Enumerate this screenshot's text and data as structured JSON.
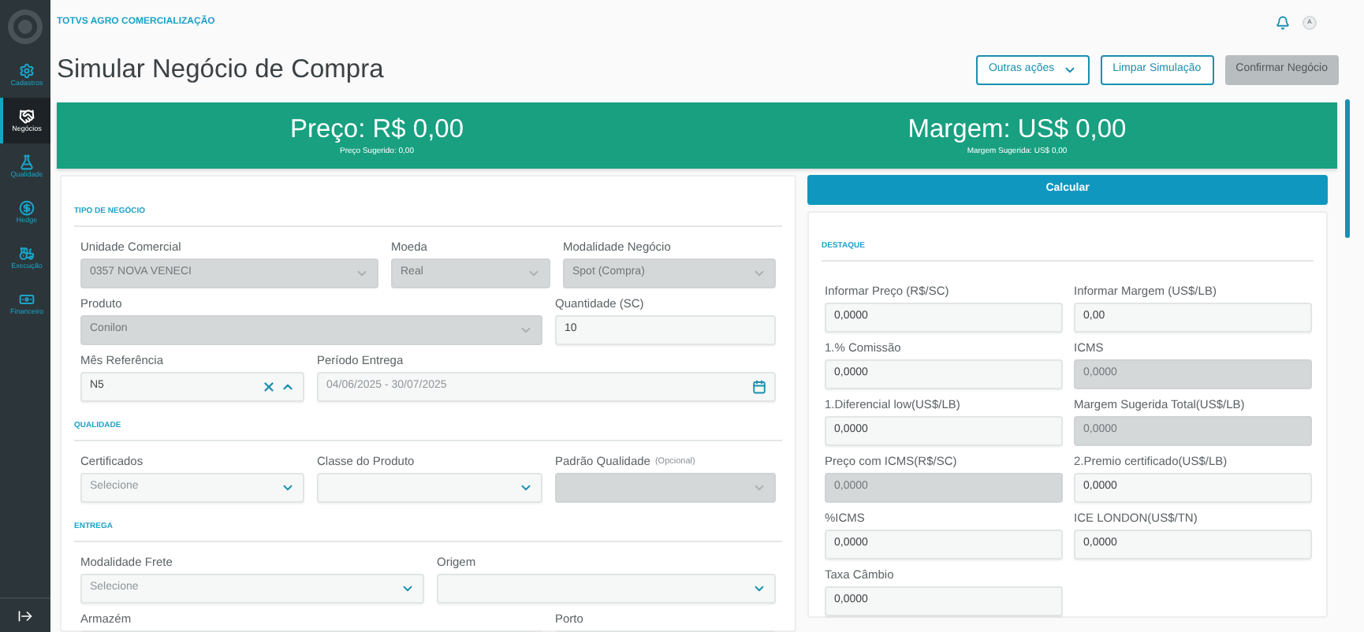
{
  "sidebar": {
    "items": [
      {
        "label": "Cadastros",
        "selected": false
      },
      {
        "label": "Negócios",
        "selected": true
      },
      {
        "label": "Qualidade",
        "selected": false
      },
      {
        "label": "Hedge",
        "selected": false
      },
      {
        "label": "Execução",
        "selected": false
      },
      {
        "label": "Financeiro",
        "selected": false
      }
    ]
  },
  "header": {
    "brand": "TOTVS AGRO COMERCIALIZAÇÃO",
    "avatar": "A",
    "title": "Simular Negócio de Compra",
    "actions": [
      {
        "label": "Outras ações",
        "kind": "menu",
        "disabled": false
      },
      {
        "label": "Limpar Simulação",
        "kind": "plain",
        "disabled": false
      },
      {
        "label": "Confirmar Negócio",
        "kind": "plain",
        "disabled": true
      }
    ]
  },
  "banner": [
    {
      "value": "Preço: R$ 0,00",
      "note": "Preço Sugerido: 0,00"
    },
    {
      "value": "Margem: US$ 0,00",
      "note": "Margem Sugerida: US$ 0,00"
    }
  ],
  "form": {
    "sections": [
      {
        "title": "TIPO DE NEGÓCIO",
        "rows": [
          {
            "fields": [
              {
                "label": "Unidade Comercial",
                "kind": "select",
                "value": "0357 NOVA VENECI",
                "disabled": true
              },
              {
                "label": "Moeda",
                "kind": "select",
                "value": "Real",
                "disabled": true
              },
              {
                "label": "Modalidade Negócio",
                "kind": "select",
                "value": "Spot (Compra)",
                "disabled": true
              }
            ]
          },
          {
            "fields": [
              {
                "label": "Produto",
                "kind": "select",
                "value": "Conilon",
                "disabled": true
              },
              {
                "label": "Quantidade (SC)",
                "kind": "input",
                "value": "10",
                "disabled": false
              }
            ]
          },
          {
            "fields": [
              {
                "label": "Mês Referência",
                "kind": "combo",
                "value": "N5",
                "disabled": false
              },
              {
                "label": "Período Entrega",
                "kind": "date",
                "placeholder": "04/06/2025 - 30/07/2025",
                "disabled": false
              }
            ]
          }
        ]
      },
      {
        "title": "QUALIDADE",
        "rows": [
          {
            "fields": [
              {
                "label": "Certificados",
                "kind": "select",
                "placeholder": "Selecione",
                "disabled": false
              },
              {
                "label": "Classe do Produto",
                "kind": "select",
                "disabled": false
              },
              {
                "label": "Padrão Qualidade",
                "optional": "(Opcional)",
                "kind": "select",
                "disabled": true
              }
            ]
          }
        ]
      },
      {
        "title": "ENTREGA",
        "rows": [
          {
            "fields": [
              {
                "label": "Modalidade Frete",
                "kind": "select",
                "placeholder": "Selecione",
                "disabled": false
              },
              {
                "label": "Origem",
                "kind": "select",
                "disabled": false
              }
            ]
          },
          {
            "fields": [
              {
                "label": "Armazém",
                "disabled": false
              },
              {
                "label": "Porto",
                "disabled": false
              }
            ]
          }
        ]
      }
    ]
  },
  "calculate_button": "Calcular",
  "highlight": {
    "title": "DESTAQUE",
    "fields": [
      {
        "label": "Informar Preço (R$/SC)",
        "value": "0,0000",
        "disabled": false
      },
      {
        "label": "Informar Margem (US$/LB)",
        "value": "0,00",
        "disabled": false
      },
      {
        "label": "1.% Comissão",
        "value": "0,0000",
        "disabled": false
      },
      {
        "label": "ICMS",
        "value": "0,0000",
        "disabled": true
      },
      {
        "label": "1.Diferencial low(US$/LB)",
        "value": "0,0000",
        "disabled": false
      },
      {
        "label": "Margem Sugerida Total(US$/LB)",
        "value": "0,0000",
        "disabled": true
      },
      {
        "label": "Preço com ICMS(R$/SC)",
        "value": "0,0000",
        "disabled": true
      },
      {
        "label": "2.Premio certificado(US$/LB)",
        "value": "0,0000",
        "disabled": false
      },
      {
        "label": "%ICMS",
        "value": "0,0000",
        "disabled": false
      },
      {
        "label": "ICE LONDON(US$/TN)",
        "value": "0,0000",
        "disabled": false
      },
      {
        "label": "Taxa Câmbio",
        "value": "0,0000",
        "disabled": false
      }
    ]
  }
}
